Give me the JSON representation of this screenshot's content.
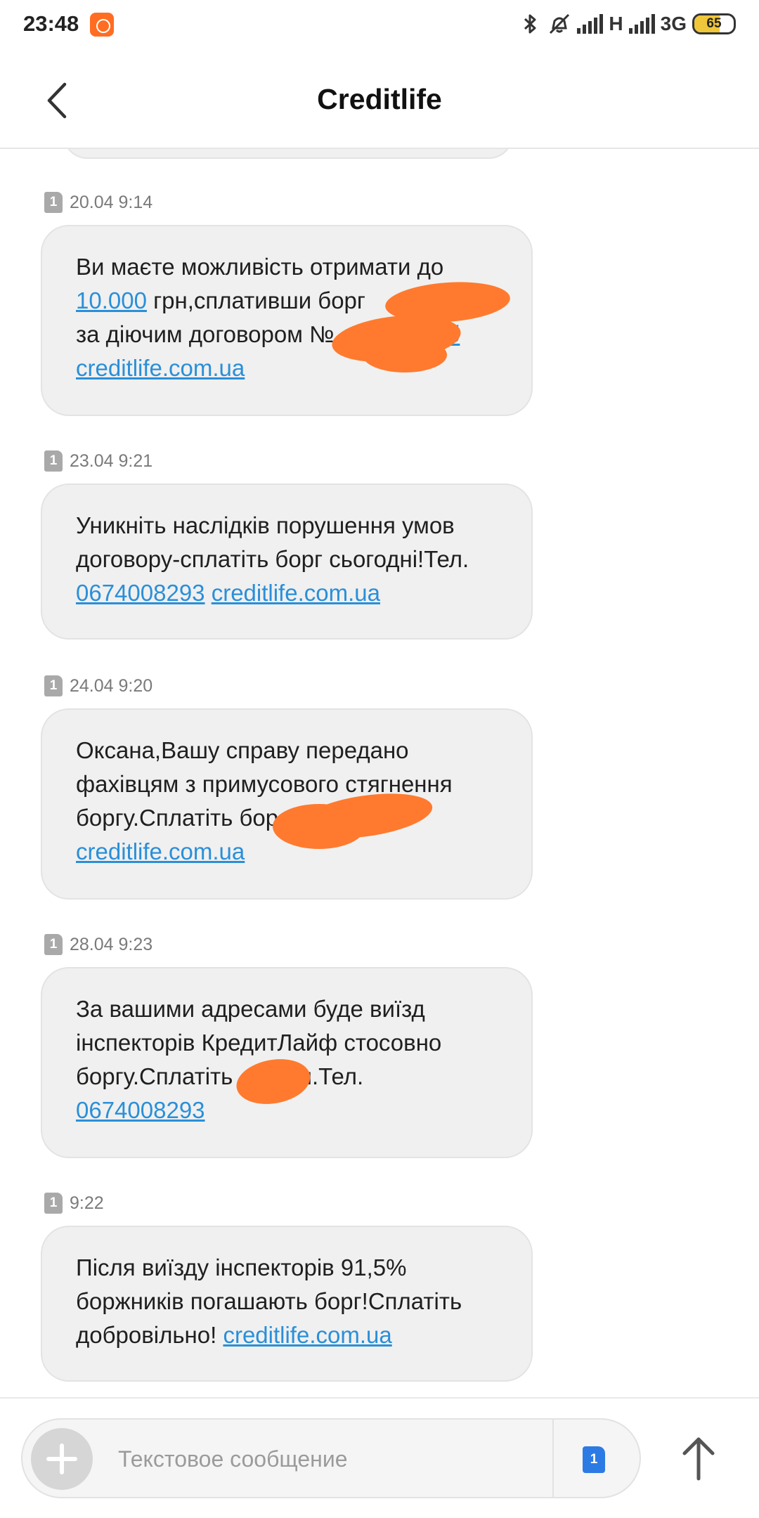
{
  "status_bar": {
    "time": "23:48",
    "network_label_1": "H",
    "network_label_2": "3G",
    "battery_level": "65",
    "battery_fraction": 0.65,
    "icons": [
      "app-notification-icon",
      "bluetooth-icon",
      "vibrate-off-icon",
      "signal-icon",
      "signal-icon",
      "battery-icon"
    ]
  },
  "header": {
    "title": "Creditlife"
  },
  "messages": [
    {
      "sim": "1",
      "stamp": "20.04 9:14",
      "text_a": "Ви маєте можливість отримати до ",
      "link_a": "10.000",
      "text_b": " грн,сплативши борг",
      "text_c": "за діючим договором №",
      "link_b": "б",
      "link_c": "creditlife.com.ua"
    },
    {
      "sim": "1",
      "stamp": "23.04 9:21",
      "text_a": "Уникніть наслідків порушення умов договору-сплатіть борг сьогодні!Тел. ",
      "link_a": "0674008293",
      "link_b": "creditlife.com.ua"
    },
    {
      "sim": "1",
      "stamp": "24.04 9:20",
      "text_a": "Оксана,Вашу справу передано фахівцям з примусового стягнення боргу.Сплатіть бор",
      "link_a": "creditlife.com.ua"
    },
    {
      "sim": "1",
      "stamp": "28.04 9:23",
      "text_a": "За вашими адресами буде виїзд інспекторів КредитЛайф стосовно боргу.Сплатіть",
      "text_b": "грн.Тел.",
      "link_a": "0674008293"
    },
    {
      "sim": "1",
      "stamp": "9:22",
      "text_a": "Після виїзду інспекторів 91,5% боржників погашають борг!Сплатіть добровільно! ",
      "link_a": "creditlife.com.ua"
    }
  ],
  "composer": {
    "placeholder": "Текстовое сообщение",
    "sim_label": "1"
  }
}
